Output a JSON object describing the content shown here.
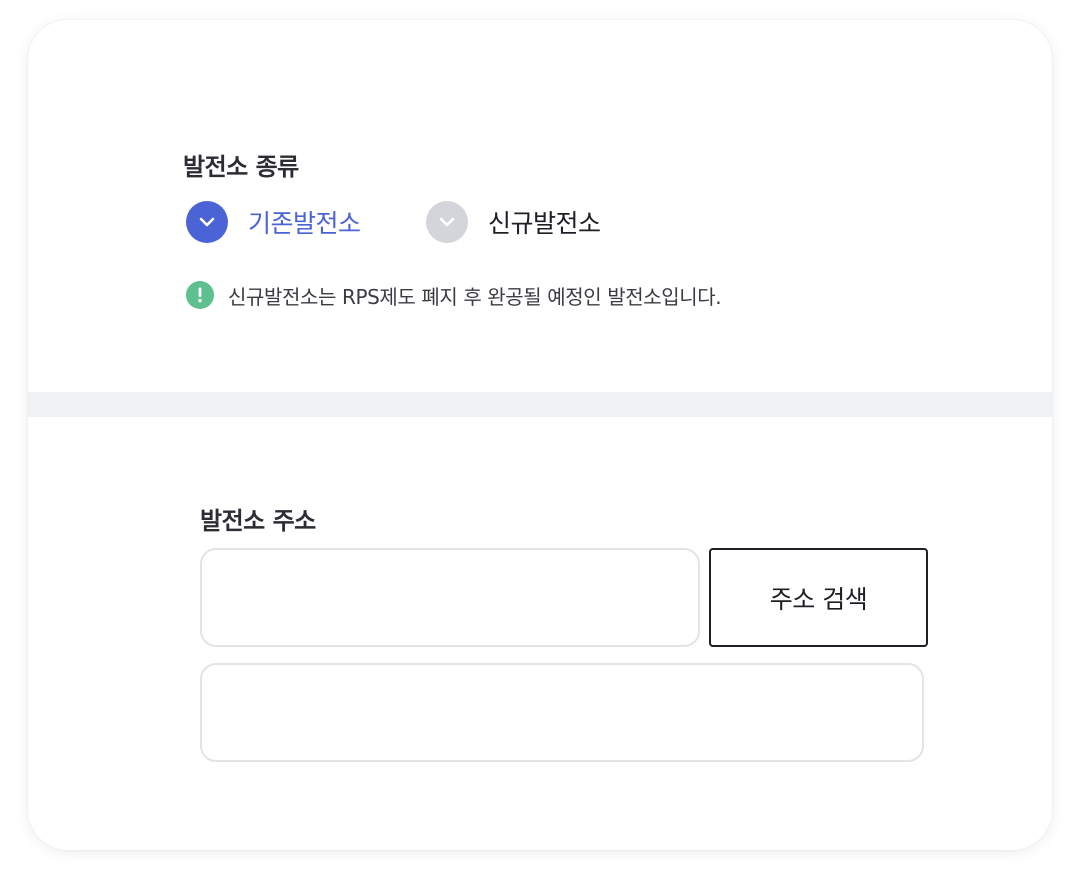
{
  "plant_type": {
    "title": "발전소 종류",
    "options": [
      {
        "label": "기존발전소",
        "selected": true
      },
      {
        "label": "신규발전소",
        "selected": false
      }
    ],
    "notice": "신규발전소는 RPS제도 폐지 후 완공될 예정인 발전소입니다."
  },
  "plant_address": {
    "title": "발전소 주소",
    "address_value": "",
    "detail_value": "",
    "search_button": "주소 검색"
  },
  "colors": {
    "accent": "#4a64d6",
    "unselected": "#d3d5da",
    "notice_icon": "#5fc08f",
    "divider": "#f1f2f4",
    "input_border": "#e3e4e7"
  },
  "icons": {
    "selected_check": "chevron-down-icon",
    "unselected_check": "chevron-down-icon",
    "notice": "exclamation-icon"
  }
}
